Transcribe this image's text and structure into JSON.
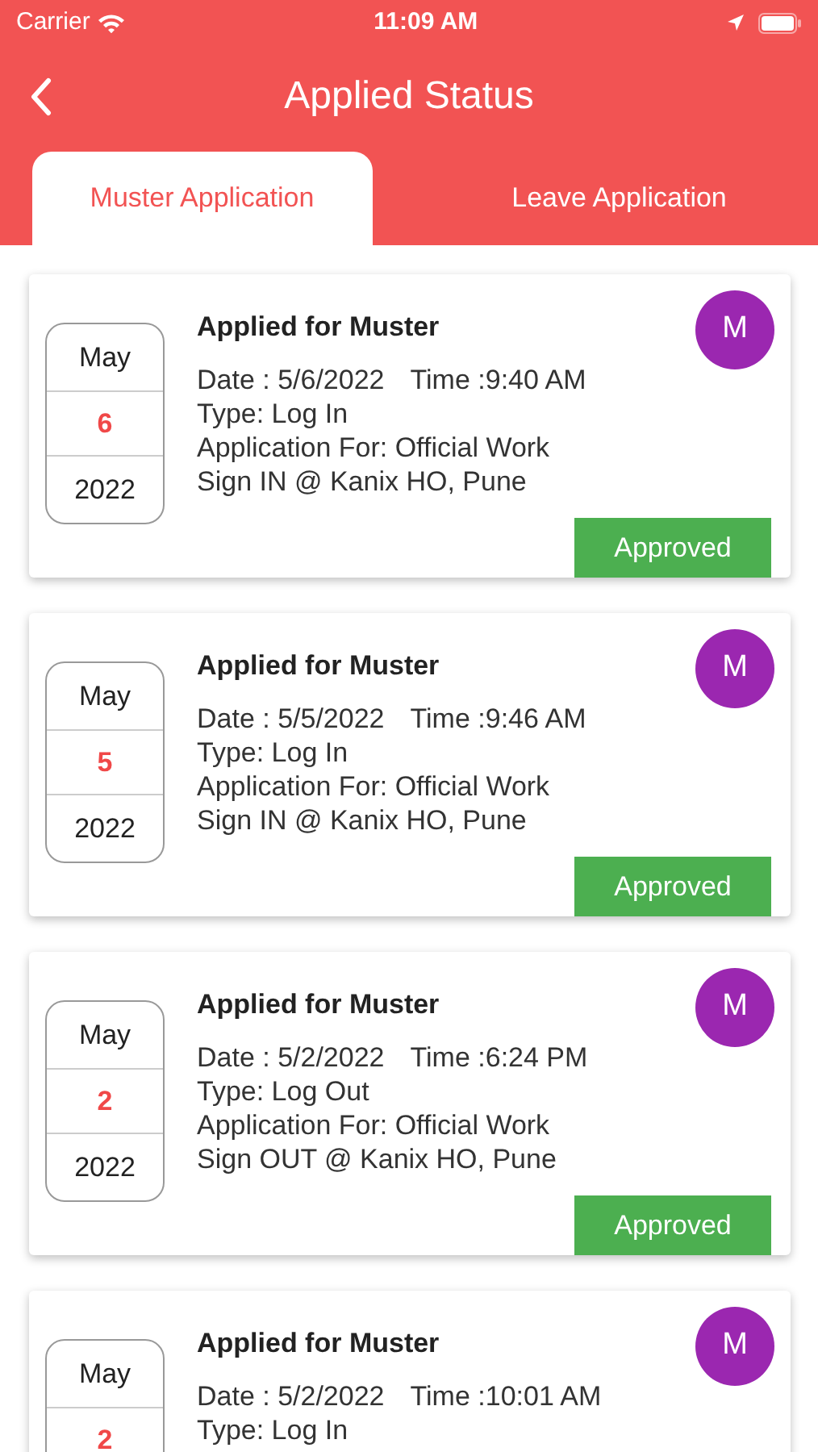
{
  "status_bar": {
    "carrier": "Carrier",
    "time": "11:09 AM"
  },
  "header": {
    "title": "Applied Status"
  },
  "tabs": [
    {
      "label": "Muster Application",
      "selected": true
    },
    {
      "label": "Leave Application",
      "selected": false
    }
  ],
  "applications": [
    {
      "month": "May",
      "day": "6",
      "year": "2022",
      "title": "Applied for Muster",
      "date": "Date : 5/6/2022",
      "time": "Time :9:40 AM",
      "type": "Type: Log In",
      "application_for": "Application For: Official Work",
      "sign": "Sign IN @ Kanix HO, Pune",
      "avatar": "M",
      "status": "Approved"
    },
    {
      "month": "May",
      "day": "5",
      "year": "2022",
      "title": "Applied for Muster",
      "date": "Date : 5/5/2022",
      "time": "Time :9:46 AM",
      "type": "Type: Log In",
      "application_for": "Application For: Official Work",
      "sign": "Sign IN @ Kanix HO, Pune",
      "avatar": "M",
      "status": "Approved"
    },
    {
      "month": "May",
      "day": "2",
      "year": "2022",
      "title": "Applied for Muster",
      "date": "Date : 5/2/2022",
      "time": "Time :6:24 PM",
      "type": "Type: Log Out",
      "application_for": "Application For: Official Work",
      "sign": "Sign OUT @ Kanix HO, Pune",
      "avatar": "M",
      "status": "Approved"
    },
    {
      "month": "May",
      "day": "2",
      "title": "Applied for Muster",
      "date": "Date : 5/2/2022",
      "time": "Time :10:01 AM",
      "type": "Type: Log In",
      "avatar": "M"
    }
  ]
}
